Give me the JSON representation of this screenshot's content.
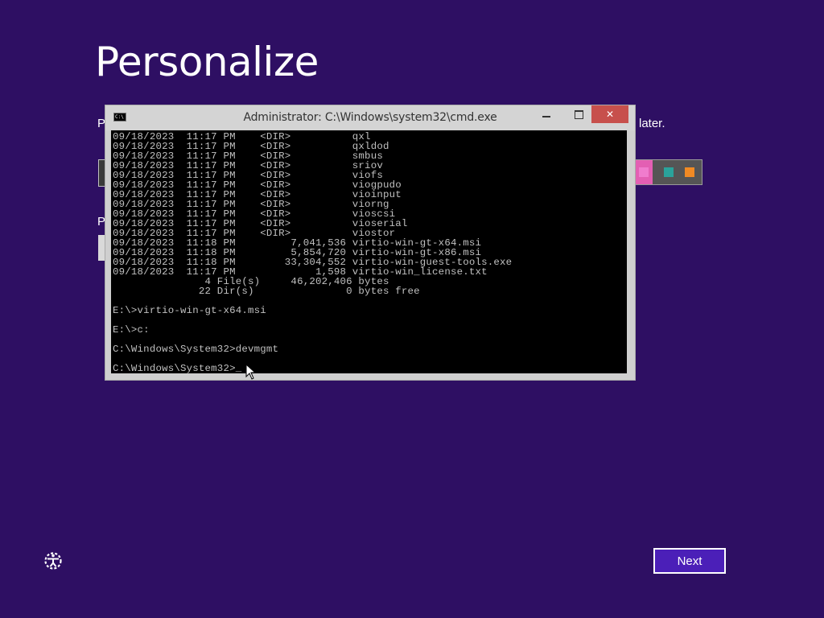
{
  "page": {
    "title": "Personalize",
    "partial_label_1": "P",
    "partial_label_2": "P",
    "partial_text_right": "later."
  },
  "colors": {
    "background": "#2e0f63",
    "accent_pink": "#e35fb3",
    "swatch_teal": "#2aa39b",
    "swatch_orange": "#f08a24",
    "next_fill": "#4b1fb8"
  },
  "cmd": {
    "icon_label": "C:\\",
    "title": "Administrator: C:\\Windows\\system32\\cmd.exe",
    "close_glyph": "✕",
    "lines": [
      "09/18/2023  11:17 PM    <DIR>          qxl",
      "09/18/2023  11:17 PM    <DIR>          qxldod",
      "09/18/2023  11:17 PM    <DIR>          smbus",
      "09/18/2023  11:17 PM    <DIR>          sriov",
      "09/18/2023  11:17 PM    <DIR>          viofs",
      "09/18/2023  11:17 PM    <DIR>          viogpudo",
      "09/18/2023  11:17 PM    <DIR>          vioinput",
      "09/18/2023  11:17 PM    <DIR>          viorng",
      "09/18/2023  11:17 PM    <DIR>          vioscsi",
      "09/18/2023  11:17 PM    <DIR>          vioserial",
      "09/18/2023  11:17 PM    <DIR>          viostor",
      "09/18/2023  11:18 PM         7,041,536 virtio-win-gt-x64.msi",
      "09/18/2023  11:18 PM         5,854,720 virtio-win-gt-x86.msi",
      "09/18/2023  11:18 PM        33,304,552 virtio-win-guest-tools.exe",
      "09/18/2023  11:17 PM             1,598 virtio-win_license.txt",
      "               4 File(s)     46,202,406 bytes",
      "              22 Dir(s)               0 bytes free",
      "",
      "E:\\>virtio-win-gt-x64.msi",
      "",
      "E:\\>c:",
      "",
      "C:\\Windows\\System32>devmgmt",
      "",
      "C:\\Windows\\System32>_"
    ]
  },
  "footer": {
    "next_label": "Next",
    "ease_of_access_icon": "ease-of-access-icon"
  }
}
